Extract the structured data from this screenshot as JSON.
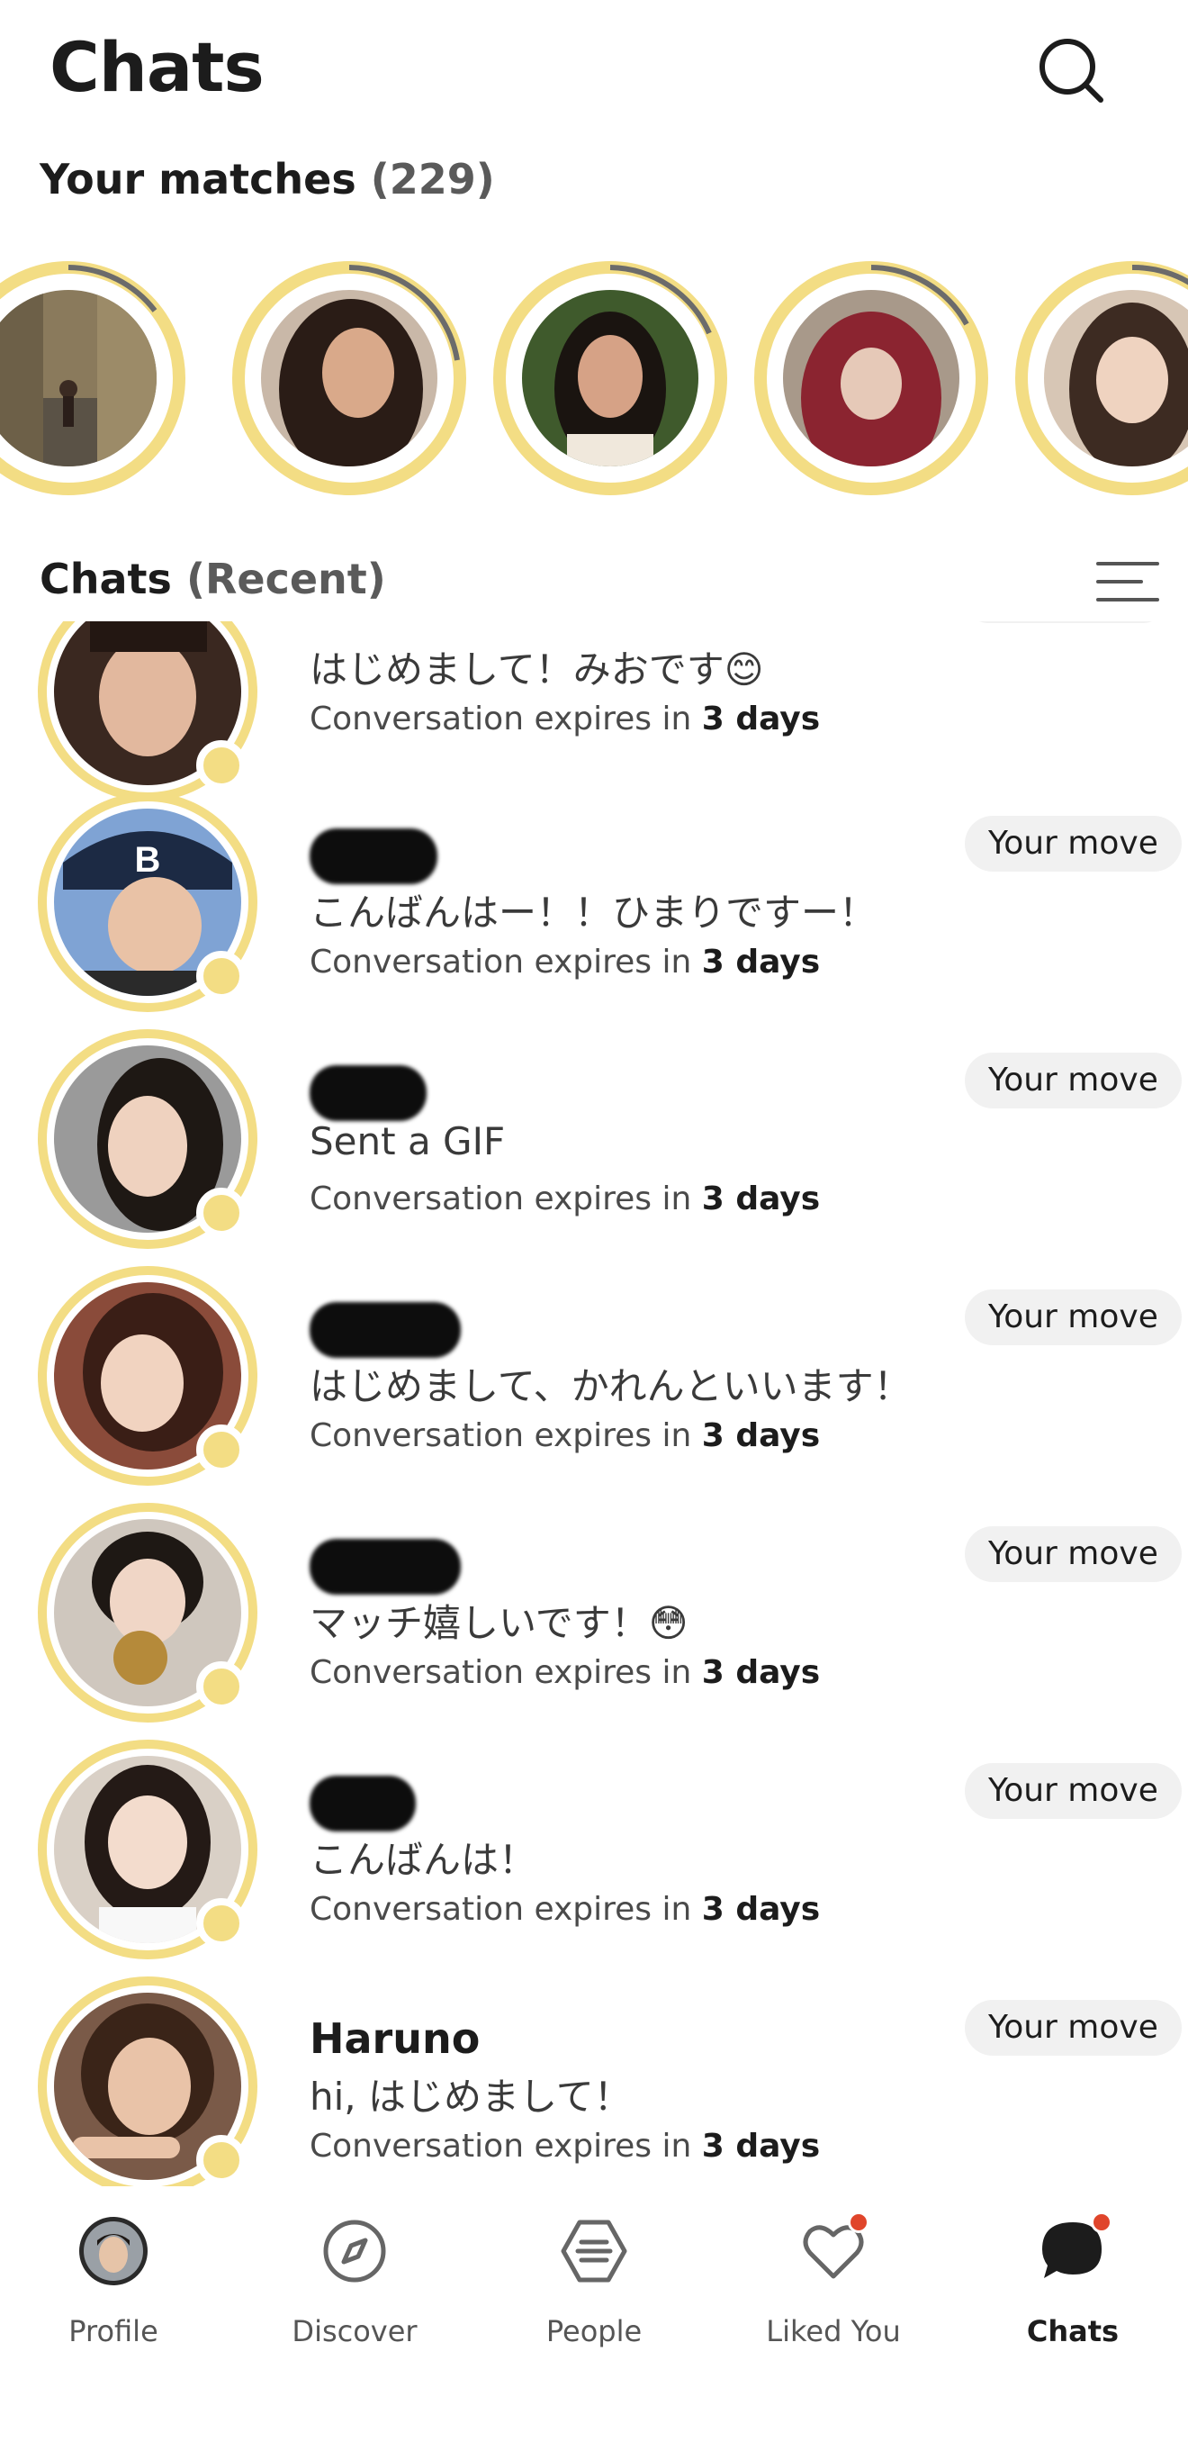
{
  "header": {
    "title": "Chats",
    "search_icon": "search-icon"
  },
  "matches": {
    "label": "Your matches",
    "count": "(229)",
    "ring_color": "#f3dd84",
    "items": [
      {
        "photo_tone": "#8a7a5c"
      },
      {
        "photo_tone": "#b59780"
      },
      {
        "photo_tone": "#3f5a2c"
      },
      {
        "photo_tone": "#8b2430"
      },
      {
        "photo_tone": "#d7c6b5"
      }
    ]
  },
  "chats_section": {
    "label": "Chats",
    "sub_label": "(Recent)",
    "filter_icon": "filter-lines-icon"
  },
  "chats": [
    {
      "name": "",
      "name_hidden": true,
      "message": "はじめまして！みおです😊",
      "expires_text": "Conversation expires in ",
      "expires_value": "3 days",
      "pill": "",
      "photo_tone": "#6b4e3d"
    },
    {
      "name": "",
      "name_hidden": true,
      "message": "こんばんはー！！ひまりですー！",
      "expires_text": "Conversation expires in ",
      "expires_value": "3 days",
      "pill": "Your move",
      "photo_tone": "#4a6fa5"
    },
    {
      "name": "",
      "name_hidden": true,
      "message": "Sent a GIF",
      "expires_text": "Conversation expires in ",
      "expires_value": "3 days",
      "pill": "Your move",
      "photo_tone": "#6e6e6e"
    },
    {
      "name": "",
      "name_hidden": true,
      "message": "はじめまして、かれんといいます！",
      "expires_text": "Conversation expires in ",
      "expires_value": "3 days",
      "pill": "Your move",
      "photo_tone": "#8a4b3a"
    },
    {
      "name": "",
      "name_hidden": true,
      "message": "マッチ嬉しいです！😳",
      "expires_text": "Conversation expires in ",
      "expires_value": "3 days",
      "pill": "Your move",
      "photo_tone": "#a09890"
    },
    {
      "name": "",
      "name_hidden": true,
      "message": "こんばんは！",
      "expires_text": "Conversation expires in ",
      "expires_value": "3 days",
      "pill": "Your move",
      "photo_tone": "#c9b8a8"
    },
    {
      "name": "Haruno",
      "name_hidden": false,
      "message": "hi, はじめまして！",
      "expires_text": "Conversation expires in ",
      "expires_value": "3 days",
      "pill": "Your move",
      "photo_tone": "#7a5a48"
    }
  ],
  "nav": {
    "items": [
      {
        "label": "Profile",
        "icon": "profile-avatar-icon",
        "active": false,
        "badge": false
      },
      {
        "label": "Discover",
        "icon": "compass-icon",
        "active": false,
        "badge": false
      },
      {
        "label": "People",
        "icon": "people-hexagon-icon",
        "active": false,
        "badge": false
      },
      {
        "label": "Liked You",
        "icon": "heart-icon",
        "active": false,
        "badge": true
      },
      {
        "label": "Chats",
        "icon": "chat-bubble-icon",
        "active": true,
        "badge": true
      }
    ],
    "badge_color": "#e0452b"
  }
}
